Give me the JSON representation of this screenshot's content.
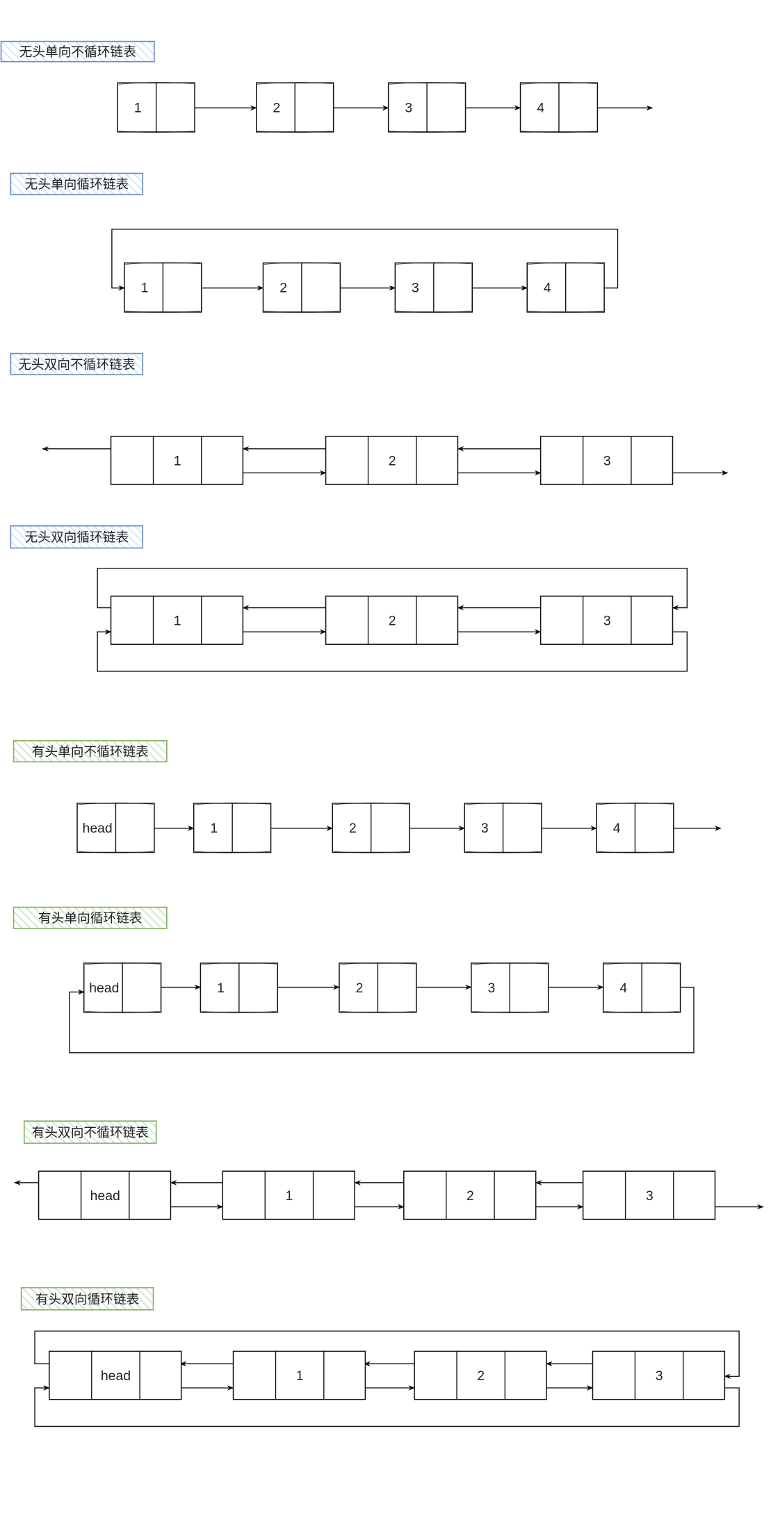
{
  "colors": {
    "blue_stroke": "#6c8ebf",
    "blue_fill": "#dae8fc",
    "green_stroke": "#82b366",
    "green_fill": "#d5e8d4",
    "line": "#111111"
  },
  "sections": [
    {
      "title": "无头单向不循环链表",
      "theme": "blue",
      "kind": "singly, non-circular",
      "nodes": [
        "1",
        "2",
        "3",
        "4"
      ]
    },
    {
      "title": "无头单向循环链表",
      "theme": "blue",
      "kind": "singly, circular",
      "nodes": [
        "1",
        "2",
        "3",
        "4"
      ]
    },
    {
      "title": "无头双向不循环链表",
      "theme": "blue",
      "kind": "doubly, non-circular",
      "nodes": [
        "1",
        "2",
        "3"
      ]
    },
    {
      "title": "无头双向循环链表",
      "theme": "blue",
      "kind": "doubly, circular",
      "nodes": [
        "1",
        "2",
        "3"
      ]
    },
    {
      "title": "有头单向不循环链表",
      "theme": "green",
      "kind": "singly, non-circular, with head",
      "nodes": [
        "head",
        "1",
        "2",
        "3",
        "4"
      ]
    },
    {
      "title": "有头单向循环链表",
      "theme": "green",
      "kind": "singly, circular, with head",
      "nodes": [
        "head",
        "1",
        "2",
        "3",
        "4"
      ]
    },
    {
      "title": "有头双向不循环链表",
      "theme": "green",
      "kind": "doubly, non-circular, with head",
      "nodes": [
        "head",
        "1",
        "2",
        "3"
      ]
    },
    {
      "title": "有头双向循环链表",
      "theme": "green",
      "kind": "doubly, circular, with head",
      "nodes": [
        "head",
        "1",
        "2",
        "3"
      ]
    }
  ]
}
